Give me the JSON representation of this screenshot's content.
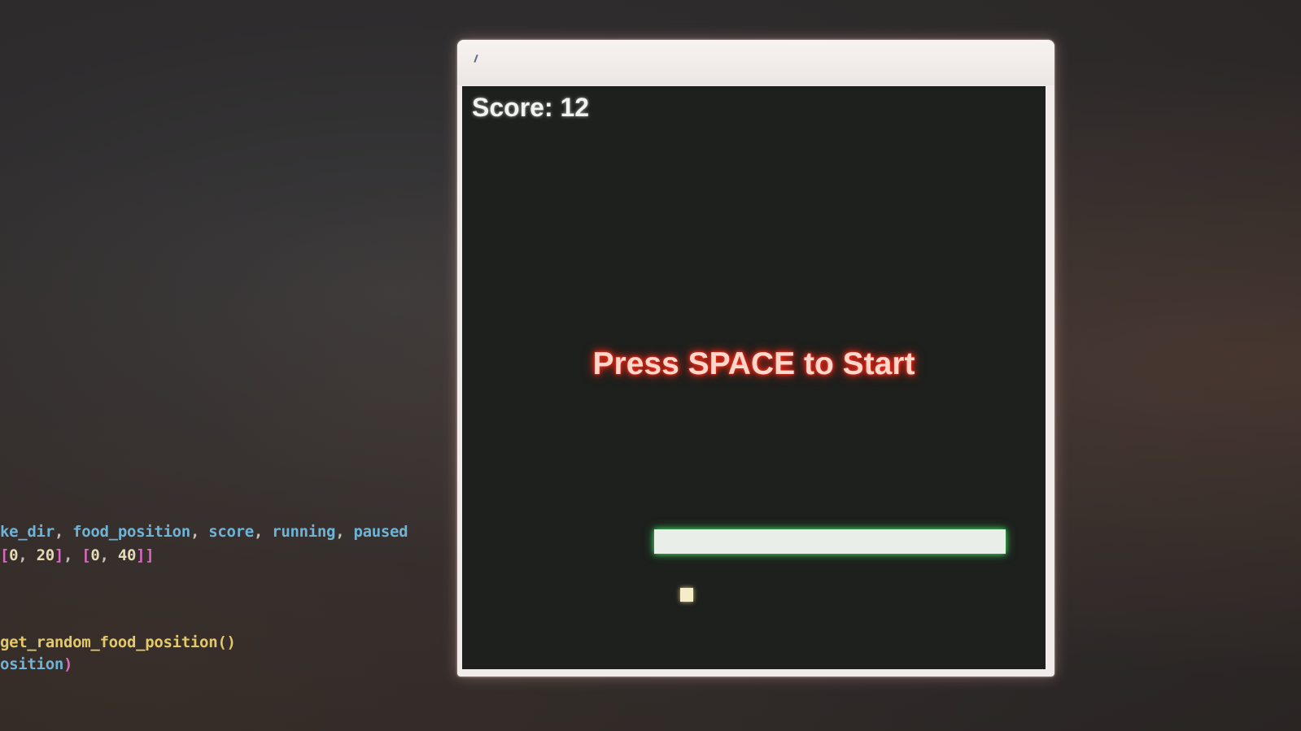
{
  "background_code": {
    "line1": {
      "idents": [
        "ke_dir",
        "food_position",
        "score",
        "running",
        "paused"
      ],
      "sep": ", "
    },
    "line2": {
      "open": "[",
      "pair1_open": "[",
      "pair1_a": "0",
      "pair1_b": "20",
      "pair1_close": "]",
      "comma": ", ",
      "pair2_open": "[",
      "pair2_a": "0",
      "pair2_b": "40",
      "pair2_close": "]",
      "close": "]"
    },
    "line3": {
      "call": "get_random_food_position()"
    },
    "line4": {
      "text": "osition",
      "paren": ")"
    }
  },
  "game": {
    "score_text": "Score: 12",
    "start_prompt": "Press SPACE to Start"
  },
  "colors": {
    "snake_glow": "#3fd15a",
    "prompt_glow": "#ff2a1a",
    "canvas_bg": "#1d201d"
  }
}
